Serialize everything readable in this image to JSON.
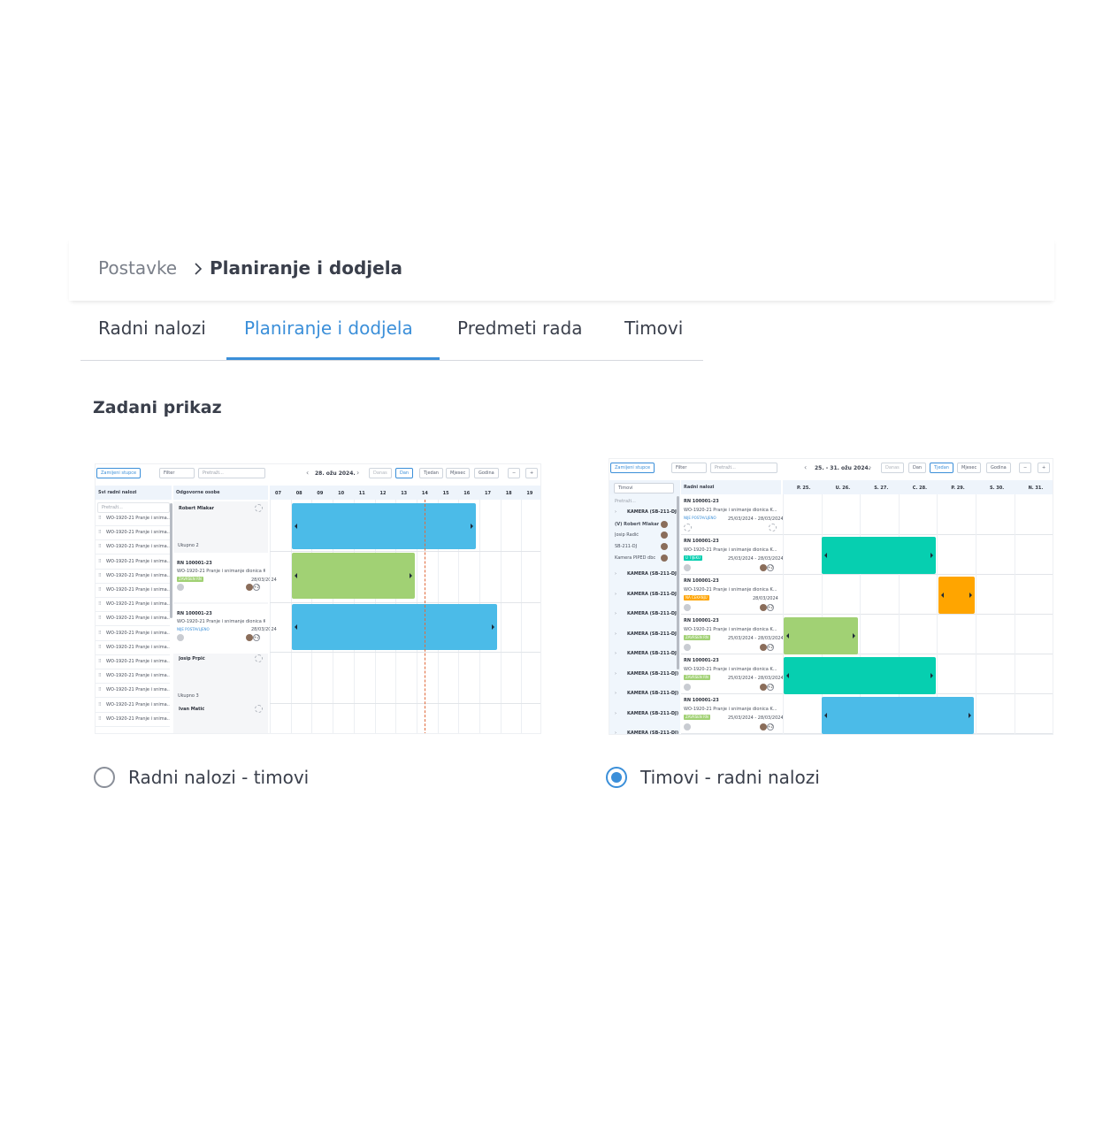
{
  "breadcrumb": {
    "parent": "Postavke",
    "current": "Planiranje i dodjela"
  },
  "tabs": [
    {
      "label": "Radni nalozi"
    },
    {
      "label": "Planiranje i dodjela"
    },
    {
      "label": "Predmeti rada"
    },
    {
      "label": "Timovi"
    }
  ],
  "section_title": "Zadani prikaz",
  "options": [
    {
      "label": "Radni nalozi - timovi",
      "selected": false
    },
    {
      "label": "Timovi - radni nalozi",
      "selected": true
    }
  ],
  "preview_left": {
    "toolbar": {
      "swap": "Zamijeni stupce",
      "filter": "Filter",
      "search": "Pretraži...",
      "date": "28. ožu 2024.",
      "today": "Danas",
      "day": "Dan",
      "week": "Tjedan",
      "month": "Mjesec",
      "year": "Godina"
    },
    "columns": {
      "all": "Svi radni nalozi",
      "responsible": "Odgovorne osobe"
    },
    "search": "Pretraži...",
    "hours": [
      "07",
      "08",
      "09",
      "10",
      "11",
      "12",
      "13",
      "14",
      "15",
      "16",
      "17",
      "18",
      "19"
    ],
    "orders": [
      "WO-1920-21 Pranje i snima...",
      "WO-1920-21 Pranje i snima...",
      "WO-1920-21 Pranje i snima...",
      "WO-1920-21 Pranje i snima...",
      "WO-1920-21 Pranje i snima...",
      "WO-1920-21 Pranje i snima...",
      "WO-1920-21 Pranje i snima...",
      "WO-1920-21 Pranje i snima...",
      "WO-1920-21 Pranje i snima...",
      "WO-1920-21 Pranje i snima...",
      "WO-1920-21 Pranje i snima...",
      "WO-1920-21 Pranje i snima...",
      "WO-1920-21 Pranje i snima...",
      "WO-1920-21 Pranje i snima...",
      "WO-1920-21 Pranje i snima..."
    ],
    "people": [
      {
        "name": "Robert Mlakar",
        "group": "Ukupno 2"
      },
      {
        "rn": "RN 100001-23",
        "wo": "WO-1920-21 Pranje i snimanje dionica K...",
        "status": "ZAVRŠEN RN",
        "date": "28/03/2024"
      },
      {
        "rn": "RN 100001-23",
        "wo": "WO-1920-21 Pranje i snimanje dionica K...",
        "status": "NIJE POSTAVLJENO",
        "date": "28/03/2024"
      },
      {
        "name": "Josip Prpić",
        "group": "Ukupno 3"
      },
      {
        "name": "Ivan Matić"
      }
    ],
    "plus": "+2"
  },
  "preview_right": {
    "toolbar": {
      "swap": "Zamijeni stupce",
      "filter": "Filter",
      "search": "Pretraži...",
      "date": "25. - 31. ožu 2024.",
      "today": "Danas",
      "day": "Dan",
      "week": "Tjedan",
      "month": "Mjesec",
      "year": "Godina"
    },
    "columns": {
      "teams": "Timovi",
      "orders": "Radni nalozi"
    },
    "search": "Pretraži...",
    "days": [
      "P. 25.",
      "U. 26.",
      "S. 27.",
      "Č. 28.",
      "P. 29.",
      "S. 30.",
      "N. 31."
    ],
    "teams": [
      {
        "label": "KAMERA (SB-211-DJ)"
      },
      {
        "label": "(V) Robert Mlakar"
      },
      {
        "label": "Josip Radić"
      },
      {
        "label": "SB-211-DJ"
      },
      {
        "label": "Kamera PIPED dbc"
      },
      {
        "label": "KAMERA (SB-211-DJ)"
      },
      {
        "label": "KAMERA (SB-211-DJ)"
      },
      {
        "label": "KAMERA (SB-211-DJ)"
      },
      {
        "label": "KAMERA (SB-211-DJ)"
      },
      {
        "label": "KAMERA (SB-211-DJ)"
      },
      {
        "label": "KAMERA (SB-211-DJ)"
      },
      {
        "label": "KAMERA (SB-211-DJ)"
      },
      {
        "label": "KAMERA (SB-211-DJ)"
      },
      {
        "label": "KAMERA (SB-211-DJ)"
      }
    ],
    "orders": [
      {
        "rn": "RN 100001-23",
        "wo": "WO-1920-21 Pranje i snimanje dionica K...",
        "status": "NIJE POSTAVLJENO",
        "dates": "25/03/2024 - 28/03/2024"
      },
      {
        "rn": "RN 100001-23",
        "wo": "WO-1920-21 Pranje i snimanje dionica K...",
        "status": "U TIJEKU",
        "dates": "25/03/2024 - 28/03/2024"
      },
      {
        "rn": "RN 100001-23",
        "wo": "WO-1920-21 Pranje i snimanje dionica K...",
        "status": "NA ČEKANJU",
        "dates": "28/03/2024"
      },
      {
        "rn": "RN 100001-23",
        "wo": "WO-1920-21 Pranje i snimanje dionica K...",
        "status": "ZAVRŠEN RN",
        "dates": "25/03/2024 - 28/03/2024"
      },
      {
        "rn": "RN 100001-23",
        "wo": "WO-1920-21 Pranje i snimanje dionica K...",
        "status": "ZAVRŠEN RN",
        "dates": "25/03/2024 - 28/03/2024"
      },
      {
        "rn": "RN 100001-23",
        "wo": "WO-1920-21 Pranje i snimanje dionica K...",
        "status": "ZAVRŠEN RN",
        "dates": "25/03/2024 - 28/03/2024"
      }
    ],
    "plus": "+2"
  },
  "colors": {
    "accent": "#3b8fd9",
    "bar_blue": "#4bbbe8",
    "bar_green": "#a1d174",
    "bar_teal": "#06cfb0",
    "bar_orange": "#ffa500",
    "timeline_red": "#e06a3b"
  },
  "icons": {
    "breadcrumb_separator": "chevron-right-icon"
  }
}
